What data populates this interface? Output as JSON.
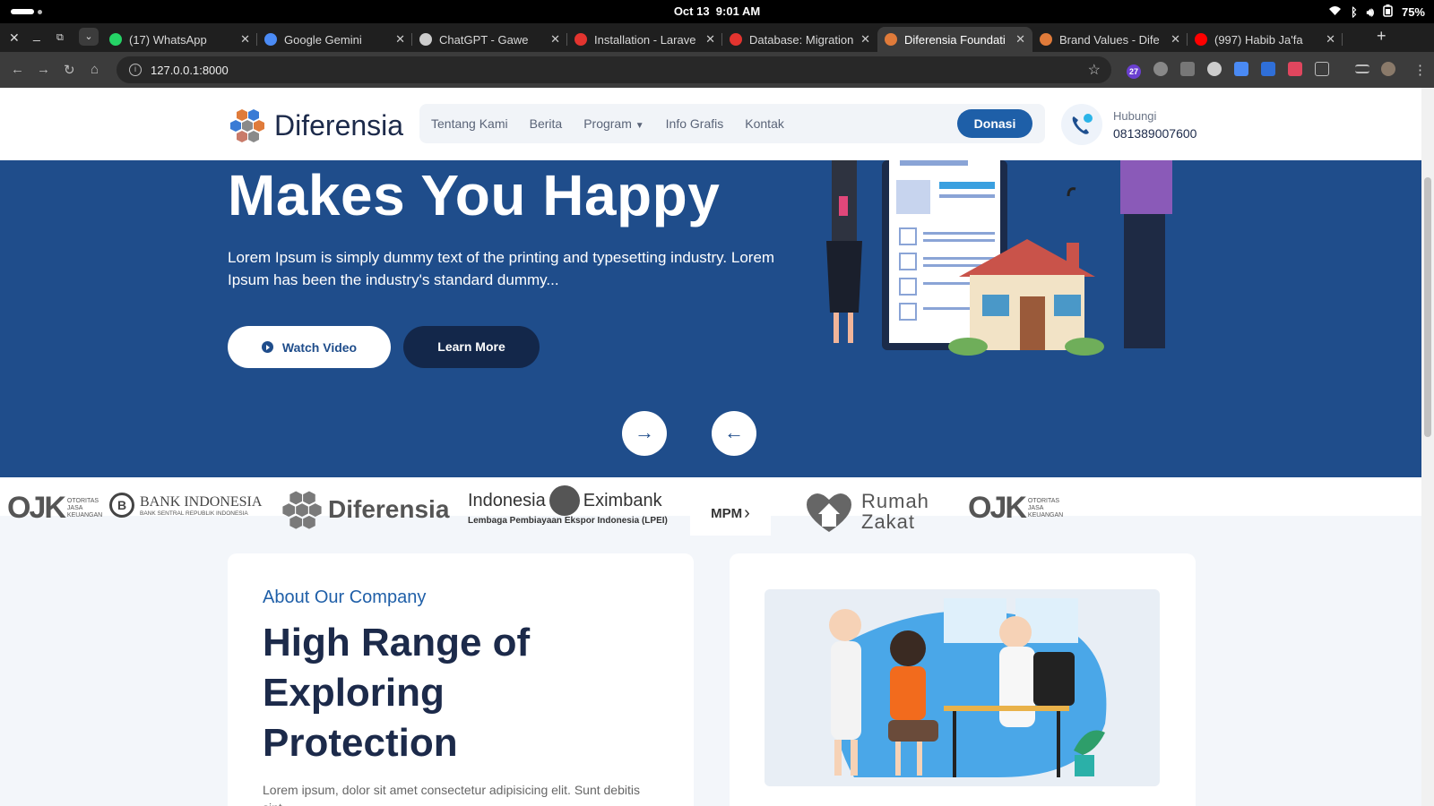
{
  "os": {
    "date": "Oct 13",
    "time": "9:01 AM",
    "battery": "75%"
  },
  "browser": {
    "tabs": [
      {
        "title": "(17) WhatsApp",
        "color": "#25d366"
      },
      {
        "title": "Google Gemini",
        "color": "#4b8bf5"
      },
      {
        "title": "ChatGPT - Gawe",
        "color": "#cccccc"
      },
      {
        "title": "Installation - Larave",
        "color": "#e3342f"
      },
      {
        "title": "Database: Migration",
        "color": "#e3342f"
      },
      {
        "title": "Diferensia Foundati",
        "color": "#e07b3a"
      },
      {
        "title": "Brand Values - Dife",
        "color": "#e07b3a"
      },
      {
        "title": "(997) Habib Ja'fa",
        "color": "#ff0000"
      }
    ],
    "url": "127.0.0.1:8000",
    "ext_badge": "27"
  },
  "header": {
    "brand": "Diferensia",
    "menu": [
      "Tentang Kami",
      "Berita",
      "Program",
      "Info Grafis",
      "Kontak"
    ],
    "donate": "Donasi",
    "contact_label": "Hubungi",
    "contact_number": "081389007600"
  },
  "hero": {
    "title": "Makes You Happy",
    "text": "Lorem Ipsum is simply dummy text of the printing and typesetting industry. Lorem Ipsum has been the industry's standard dummy...",
    "watch": "Watch Video",
    "learn": "Learn More",
    "next": "→",
    "prev": "←"
  },
  "partners": {
    "ojk_top": "OTORITAS",
    "ojk_mid": "JASA",
    "ojk_bot": "KEUANGAN",
    "bi": "BANK INDONESIA",
    "bi_sub": "BANK SENTRAL REPUBLIK INDONESIA",
    "diferensia": "Diferensia",
    "exim_a": "Indonesia",
    "exim_b": "Eximbank",
    "exim_sub": "Lembaga Pembiayaan Ekspor Indonesia (LPEI)",
    "mpm": "MPM",
    "rz_a": "Rumah",
    "rz_b": "Zakat"
  },
  "about": {
    "kicker": "About Our Company",
    "title": "High Range of Exploring Protection",
    "body": "Lorem ipsum, dolor sit amet consectetur adipisicing elit. Sunt debitis sint"
  }
}
